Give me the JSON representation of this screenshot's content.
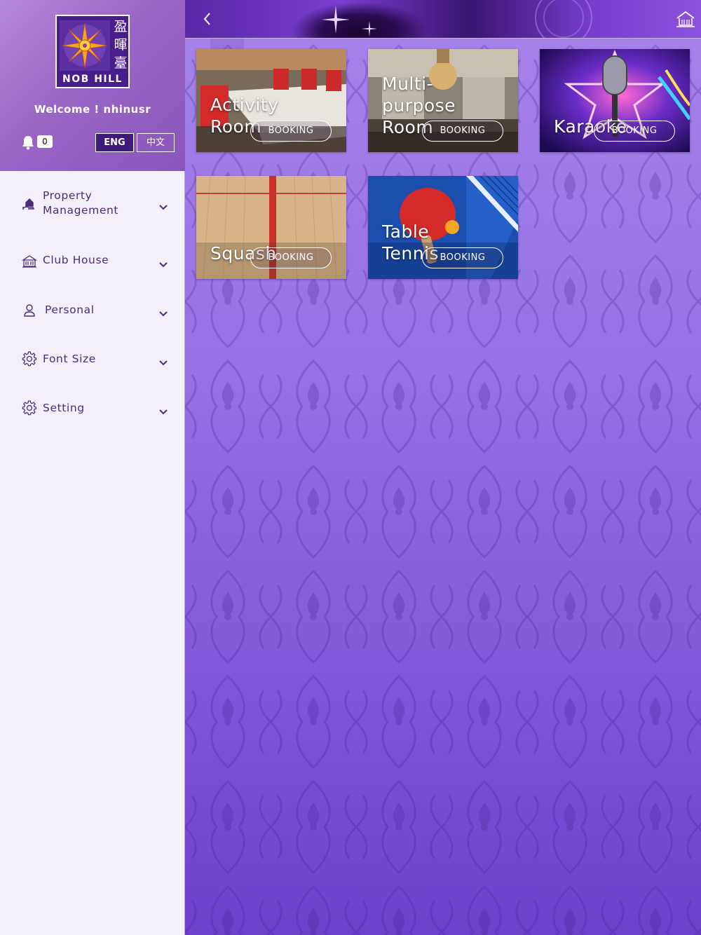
{
  "brand": {
    "name": "NOB HILL",
    "cjk": [
      "盈",
      "暉",
      "臺"
    ]
  },
  "user": {
    "welcome": "Welcome ! nhinusr",
    "notification_count": "0"
  },
  "language": {
    "eng_label": "ENG",
    "zh_label": "中文",
    "selected": "ENG"
  },
  "menu": {
    "items": [
      {
        "label": "Property\nManagement",
        "icon": "house-hand-icon"
      },
      {
        "label": "Club House",
        "icon": "clubhouse-icon"
      },
      {
        "label": "Personal",
        "icon": "person-icon"
      },
      {
        "label": "Font Size",
        "icon": "gear-icon"
      },
      {
        "label": "Setting",
        "icon": "gear-icon"
      }
    ]
  },
  "topbar": {
    "back_icon": "chevron-left-icon",
    "home_icon": "home-icon"
  },
  "facilities": [
    {
      "title": "Activity\nRoom",
      "button": "BOOKING"
    },
    {
      "title": "Multi-\npurpose\nRoom",
      "button": "BOOKING"
    },
    {
      "title": "Karaoke",
      "button": "BOOKING"
    },
    {
      "title": "Squash",
      "button": "BOOKING"
    },
    {
      "title": "Table\nTennis",
      "button": "BOOKING"
    }
  ],
  "colors": {
    "sidebar_bg": "#f4f0fa",
    "header_purple": "#9a66c6",
    "menu_text": "#4a2b7c",
    "main_purple": "#9670e4",
    "lang_selected_bg": "#3e1a7a"
  }
}
